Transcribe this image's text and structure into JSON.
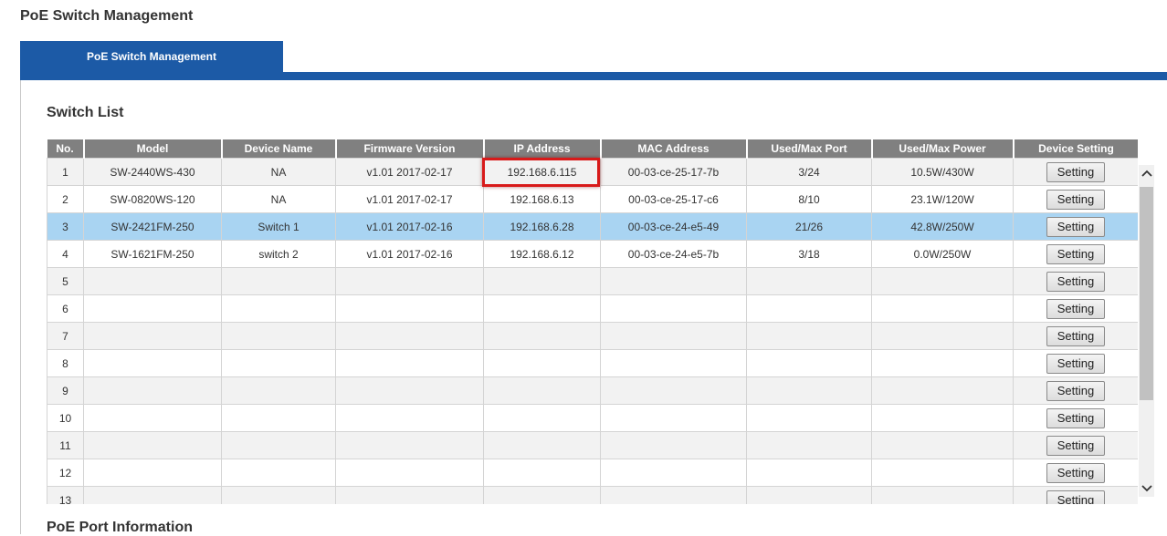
{
  "page": {
    "title": "PoE Switch Management"
  },
  "tabs": [
    {
      "label": "PoE Switch Management"
    }
  ],
  "switch_list": {
    "title": "Switch List",
    "columns": [
      "No.",
      "Model",
      "Device Name",
      "Firmware Version",
      "IP Address",
      "MAC Address",
      "Used/Max Port",
      "Used/Max Power",
      "Device Setting"
    ],
    "rows": [
      {
        "no": "1",
        "model": "SW-2440WS-430",
        "name": "NA",
        "firmware": "v1.01 2017-02-17",
        "ip": "192.168.6.115",
        "mac": "00-03-ce-25-17-7b",
        "port": "3/24",
        "power": "10.5W/430W",
        "setting": "Setting"
      },
      {
        "no": "2",
        "model": "SW-0820WS-120",
        "name": "NA",
        "firmware": "v1.01 2017-02-17",
        "ip": "192.168.6.13",
        "mac": "00-03-ce-25-17-c6",
        "port": "8/10",
        "power": "23.1W/120W",
        "setting": "Setting"
      },
      {
        "no": "3",
        "model": "SW-2421FM-250",
        "name": "Switch 1",
        "firmware": "v1.01 2017-02-16",
        "ip": "192.168.6.28",
        "mac": "00-03-ce-24-e5-49",
        "port": "21/26",
        "power": "42.8W/250W",
        "setting": "Setting"
      },
      {
        "no": "4",
        "model": "SW-1621FM-250",
        "name": "switch 2",
        "firmware": "v1.01 2017-02-16",
        "ip": "192.168.6.12",
        "mac": "00-03-ce-24-e5-7b",
        "port": "3/18",
        "power": "0.0W/250W",
        "setting": "Setting"
      },
      {
        "no": "5",
        "model": "",
        "name": "",
        "firmware": "",
        "ip": "",
        "mac": "",
        "port": "",
        "power": "",
        "setting": "Setting"
      },
      {
        "no": "6",
        "model": "",
        "name": "",
        "firmware": "",
        "ip": "",
        "mac": "",
        "port": "",
        "power": "",
        "setting": "Setting"
      },
      {
        "no": "7",
        "model": "",
        "name": "",
        "firmware": "",
        "ip": "",
        "mac": "",
        "port": "",
        "power": "",
        "setting": "Setting"
      },
      {
        "no": "8",
        "model": "",
        "name": "",
        "firmware": "",
        "ip": "",
        "mac": "",
        "port": "",
        "power": "",
        "setting": "Setting"
      },
      {
        "no": "9",
        "model": "",
        "name": "",
        "firmware": "",
        "ip": "",
        "mac": "",
        "port": "",
        "power": "",
        "setting": "Setting"
      },
      {
        "no": "10",
        "model": "",
        "name": "",
        "firmware": "",
        "ip": "",
        "mac": "",
        "port": "",
        "power": "",
        "setting": "Setting"
      },
      {
        "no": "11",
        "model": "",
        "name": "",
        "firmware": "",
        "ip": "",
        "mac": "",
        "port": "",
        "power": "",
        "setting": "Setting"
      },
      {
        "no": "12",
        "model": "",
        "name": "",
        "firmware": "",
        "ip": "",
        "mac": "",
        "port": "",
        "power": "",
        "setting": "Setting"
      },
      {
        "no": "13",
        "model": "",
        "name": "",
        "firmware": "",
        "ip": "",
        "mac": "",
        "port": "",
        "power": "",
        "setting": "Setting"
      }
    ]
  },
  "poe_port": {
    "title": "PoE Port Information"
  },
  "scrollbar": {
    "up_icon": "chevron-up-icon",
    "down_icon": "chevron-down-icon"
  },
  "colors": {
    "accent": "#1c5aa6",
    "header": "#808080",
    "selected_row": "#a9d4f2",
    "highlight_box": "#d81a1a"
  }
}
